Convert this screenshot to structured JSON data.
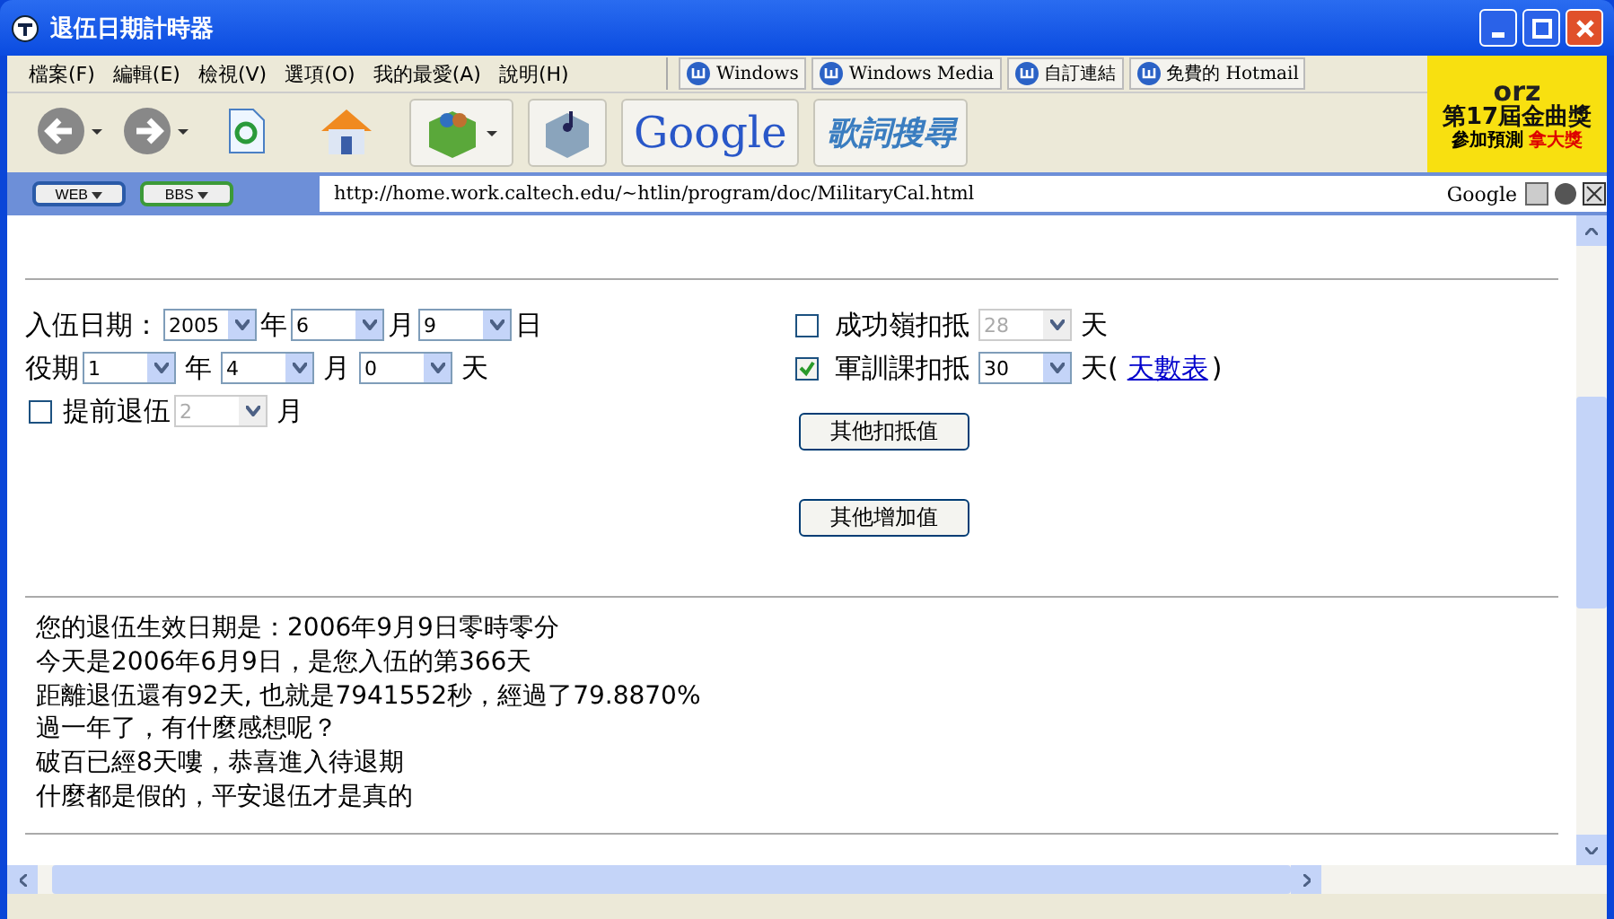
{
  "window": {
    "title": "退伍日期計時器"
  },
  "menu": [
    "檔案(F)",
    "編輯(E)",
    "檢視(V)",
    "選項(O)",
    "我的最愛(A)",
    "說明(H)"
  ],
  "links": [
    "Windows",
    "Windows Media",
    "自訂連結",
    "免費的 Hotmail"
  ],
  "toolbar": {
    "google": "Google",
    "lyrics": "歌詞搜尋"
  },
  "ad": {
    "brand": "orz",
    "headline": "第17屆金曲獎",
    "tagline": "參加預測",
    "prize": "拿大獎"
  },
  "address": {
    "buttons": [
      "WEB",
      "BBS"
    ],
    "url": "http://home.work.caltech.edu/~htlin/program/doc/MilitaryCal.html",
    "search_label": "Google"
  },
  "entry": {
    "label": "入伍日期：",
    "selects": [
      {
        "value": "2005",
        "unit": "年"
      },
      {
        "value": "6",
        "unit": "月"
      },
      {
        "value": "9",
        "unit": "日"
      }
    ]
  },
  "service": {
    "label": "役期",
    "selects": [
      {
        "value": "1",
        "unit": "年"
      },
      {
        "value": "4",
        "unit": "月"
      },
      {
        "value": "0",
        "unit": "天"
      }
    ]
  },
  "early": {
    "checked": false,
    "label": "提前退伍",
    "value": "2",
    "disabled": true,
    "unit": "月"
  },
  "deductions": [
    {
      "checked": false,
      "label": "成功嶺扣抵",
      "value": "28",
      "disabled": true,
      "unit": "天"
    },
    {
      "checked": true,
      "label": "軍訓課扣抵",
      "value": "30",
      "disabled": false,
      "unit": "天(",
      "link": "天數表",
      "suffix": ")"
    }
  ],
  "buttons": [
    "其他扣抵值",
    "其他增加值"
  ],
  "results": [
    "您的退伍生效日期是：2006年9月9日零時零分",
    "今天是2006年6月9日，是您入伍的第366天",
    "距離退伍還有92天, 也就是7941552秒，經過了79.8870%",
    "過一年了，有什麼感想呢？",
    "破百已經8天嘍，恭喜進入待退期",
    "什麼都是假的，平安退伍才是真的"
  ]
}
